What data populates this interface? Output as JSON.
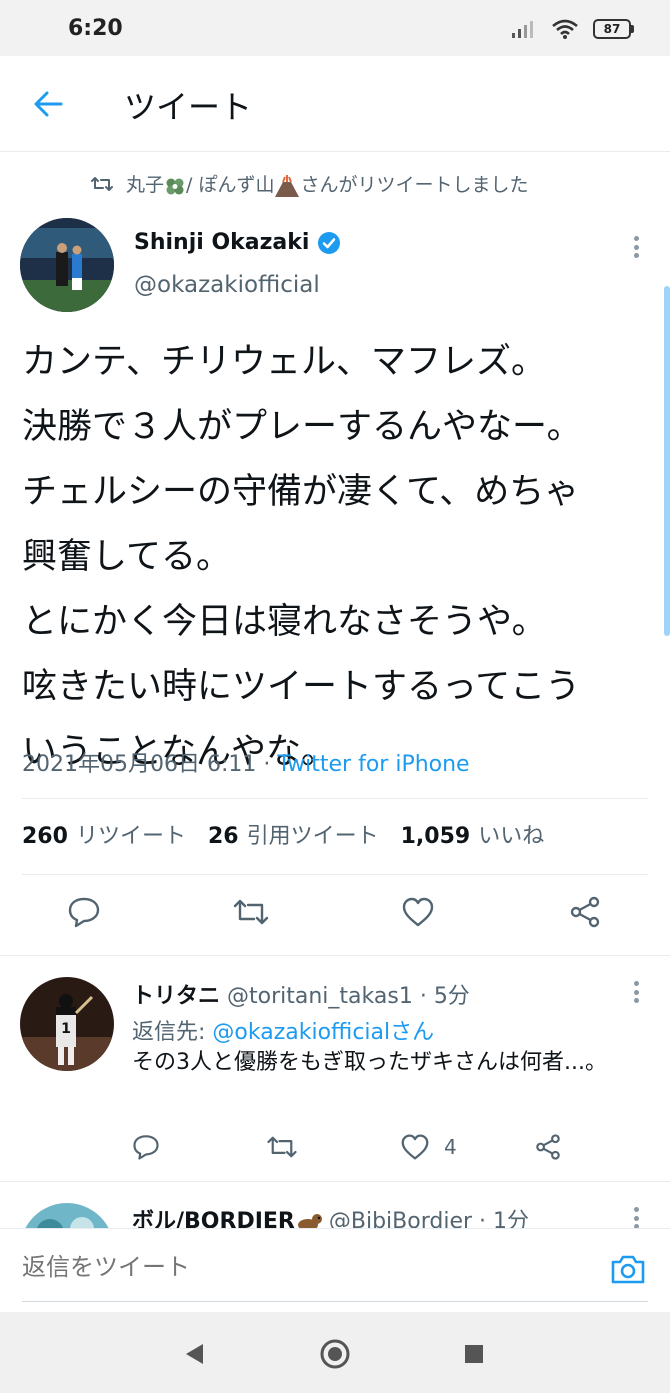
{
  "status_bar": {
    "time": "6:20",
    "battery": "87"
  },
  "header": {
    "title": "ツイート"
  },
  "retweet": {
    "text_before": "丸子",
    "text_mid": "/ ぽんず山",
    "text_after": "さんがリツイートしました"
  },
  "tweet": {
    "author_name": "Shinji Okazaki",
    "author_handle": "@okazakiofficial",
    "lines": [
      "カンテ、チリウェル、マフレズ。",
      "決勝で３人がプレーするんやなー。",
      "チェルシーの守備が凄くて、めちゃ",
      "興奮してる。",
      "とにかく今日は寝れなさそうや。",
      "呟きたい時にツイートするってこう",
      "いうことなんやな。"
    ],
    "timestamp": "2021年05月06日 6:11",
    "separator": " · ",
    "source": "Twitter for iPhone",
    "stats": {
      "retweets_count": "260",
      "retweets_label": "リツイート",
      "quotes_count": "26",
      "quotes_label": "引用ツイート",
      "likes_count": "1,059",
      "likes_label": "いいね"
    }
  },
  "replies": [
    {
      "name": "トリタニ",
      "handle": "@toritani_takas1",
      "time": "· 5分",
      "reply_to_label": "返信先: ",
      "reply_to_mention": "@okazakiofficialさん",
      "text": "その3人と優勝をもぎ取ったザキさんは何者...。",
      "likes": "4"
    },
    {
      "name": "ボル/BORDIER",
      "handle": "@BibiBordier",
      "time": "· 1分"
    }
  ],
  "reply_bar": {
    "placeholder": "返信をツイート"
  },
  "colors": {
    "accent": "#1d9bf0",
    "secondary_text": "#536471",
    "text": "#0f1419"
  }
}
